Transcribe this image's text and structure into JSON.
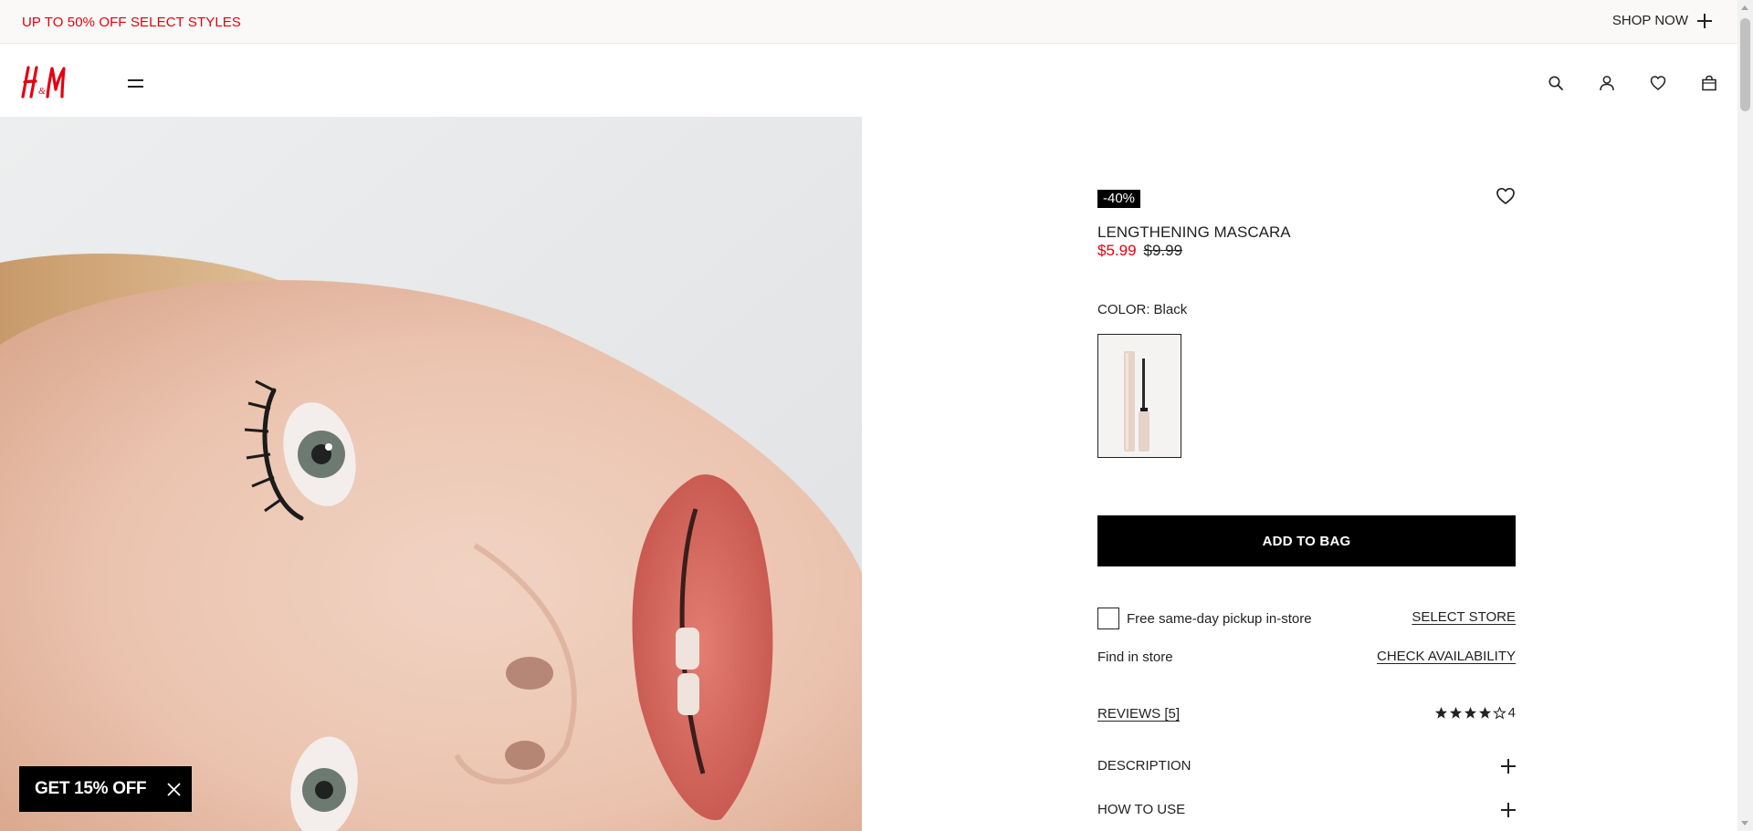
{
  "promo": {
    "text": "UP TO 50% OFF SELECT STYLES",
    "shop_now": "SHOP NOW"
  },
  "header": {
    "logo_text": "H&M",
    "icons": [
      "search-icon",
      "account-icon",
      "favorites-icon",
      "shopping-bag-icon"
    ]
  },
  "product": {
    "discount": "-40%",
    "title": "LENGTHENING MASCARA",
    "price_sale": "$5.99",
    "price_original": "$9.99",
    "color_label": "COLOR:",
    "color_value": "Black",
    "add_to_bag": "ADD TO BAG",
    "pickup_label": "Free same-day pickup in-store",
    "select_store": "SELECT STORE",
    "find_in_store": "Find in store",
    "check_availability": "CHECK AVAILABILITY",
    "reviews": "REVIEWS [5]",
    "rating_value": "4",
    "rating_stars": 4,
    "rating_max": 5,
    "accordions": [
      {
        "label": "DESCRIPTION"
      },
      {
        "label": "HOW TO USE"
      }
    ]
  },
  "popup": {
    "text": "GET 15% OFF"
  },
  "colors": {
    "brand_red": "#e50010",
    "black": "#000000"
  }
}
